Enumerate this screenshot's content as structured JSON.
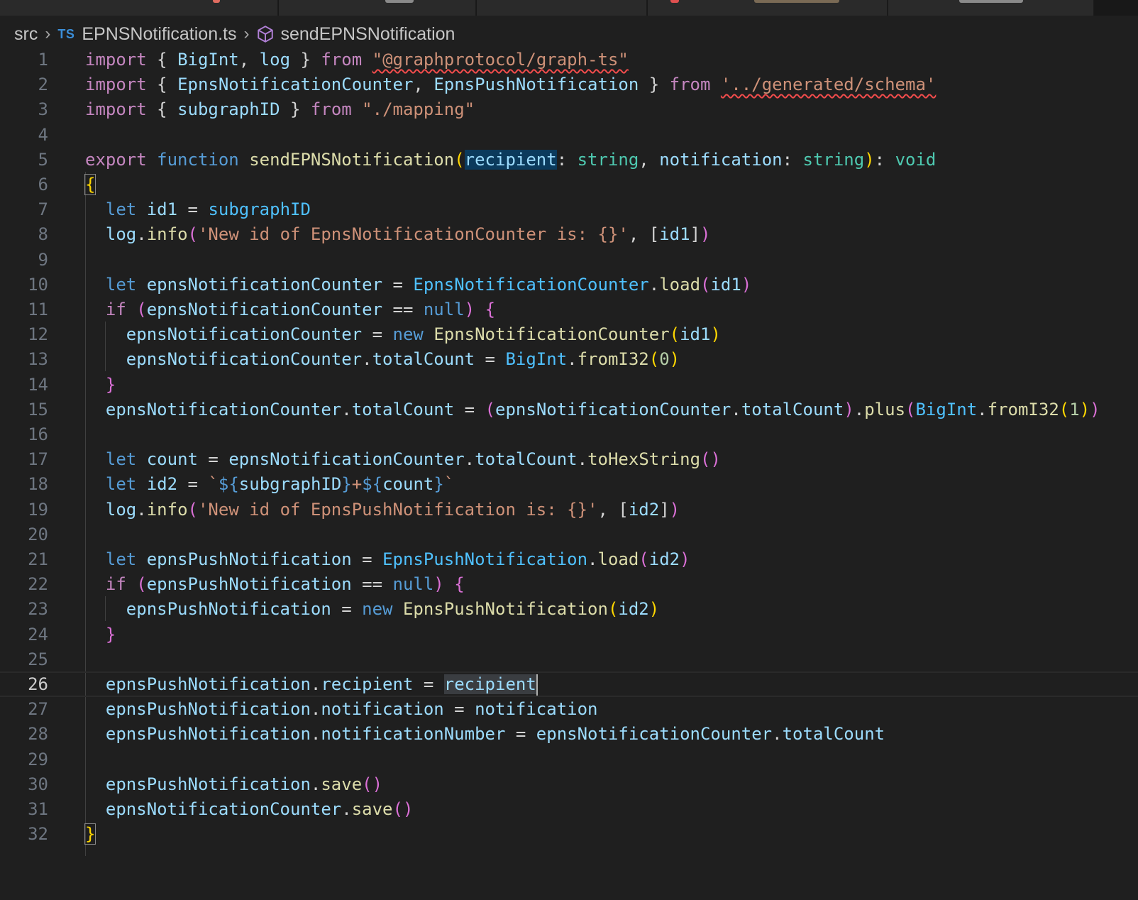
{
  "breadcrumb": {
    "folder": "src",
    "file_badge": "TS",
    "file": "EPNSNotification.ts",
    "symbol": "sendEPNSNotification"
  },
  "editor": {
    "current_line": 26,
    "lines": [
      {
        "n": "1",
        "tokens": [
          [
            "kw-ctrl",
            "import"
          ],
          [
            "p",
            " { "
          ],
          [
            "var",
            "BigInt"
          ],
          [
            "p",
            ", "
          ],
          [
            "var",
            "log"
          ],
          [
            "p",
            " } "
          ],
          [
            "kw-ctrl",
            "from"
          ],
          [
            "p",
            " "
          ],
          [
            "str squig",
            "\"@graphprotocol/graph-ts\""
          ]
        ]
      },
      {
        "n": "2",
        "tokens": [
          [
            "kw-ctrl",
            "import"
          ],
          [
            "p",
            " { "
          ],
          [
            "var",
            "EpnsNotificationCounter"
          ],
          [
            "p",
            ", "
          ],
          [
            "var",
            "EpnsPushNotification"
          ],
          [
            "p",
            " } "
          ],
          [
            "kw-ctrl",
            "from"
          ],
          [
            "p",
            " "
          ],
          [
            "str squig",
            "'../generated/schema'"
          ]
        ]
      },
      {
        "n": "3",
        "tokens": [
          [
            "kw-ctrl",
            "import"
          ],
          [
            "p",
            " { "
          ],
          [
            "var",
            "subgraphID"
          ],
          [
            "p",
            " } "
          ],
          [
            "kw-ctrl",
            "from"
          ],
          [
            "p",
            " "
          ],
          [
            "str",
            "\"./mapping\""
          ]
        ]
      },
      {
        "n": "4",
        "tokens": []
      },
      {
        "n": "5",
        "tokens": [
          [
            "kw-ctrl",
            "export"
          ],
          [
            "p",
            " "
          ],
          [
            "kw",
            "function"
          ],
          [
            "p",
            " "
          ],
          [
            "fn",
            "sendEPNSNotification"
          ],
          [
            "brk",
            "("
          ],
          [
            "var hl-word",
            "recipient"
          ],
          [
            "p",
            ": "
          ],
          [
            "type",
            "string"
          ],
          [
            "p",
            ", "
          ],
          [
            "var",
            "notification"
          ],
          [
            "p",
            ": "
          ],
          [
            "type",
            "string"
          ],
          [
            "brk",
            ")"
          ],
          [
            "p",
            ": "
          ],
          [
            "type",
            "void"
          ]
        ]
      },
      {
        "n": "6",
        "tokens": [
          [
            "brk bracket-match",
            "{"
          ]
        ]
      },
      {
        "n": "7",
        "tokens": [
          [
            "p",
            "  "
          ],
          [
            "kw",
            "let"
          ],
          [
            "p",
            " "
          ],
          [
            "var",
            "id1"
          ],
          [
            "p",
            " = "
          ],
          [
            "cls",
            "subgraphID"
          ]
        ]
      },
      {
        "n": "8",
        "tokens": [
          [
            "p",
            "  "
          ],
          [
            "var",
            "log"
          ],
          [
            "p",
            "."
          ],
          [
            "fn",
            "info"
          ],
          [
            "brk2",
            "("
          ],
          [
            "str",
            "'New id of EpnsNotificationCounter is: {}'"
          ],
          [
            "p",
            ", "
          ],
          [
            "p",
            "["
          ],
          [
            "var",
            "id1"
          ],
          [
            "p",
            "]"
          ],
          [
            "brk2",
            ")"
          ]
        ]
      },
      {
        "n": "9",
        "tokens": []
      },
      {
        "n": "10",
        "tokens": [
          [
            "p",
            "  "
          ],
          [
            "kw",
            "let"
          ],
          [
            "p",
            " "
          ],
          [
            "var",
            "epnsNotificationCounter"
          ],
          [
            "p",
            " = "
          ],
          [
            "cls",
            "EpnsNotificationCounter"
          ],
          [
            "p",
            "."
          ],
          [
            "fn",
            "load"
          ],
          [
            "brk2",
            "("
          ],
          [
            "var",
            "id1"
          ],
          [
            "brk2",
            ")"
          ]
        ]
      },
      {
        "n": "11",
        "tokens": [
          [
            "p",
            "  "
          ],
          [
            "kw-ctrl",
            "if"
          ],
          [
            "p",
            " "
          ],
          [
            "brk2",
            "("
          ],
          [
            "var",
            "epnsNotificationCounter"
          ],
          [
            "p",
            " == "
          ],
          [
            "kw",
            "null"
          ],
          [
            "brk2",
            ")"
          ],
          [
            "p",
            " "
          ],
          [
            "brk2",
            "{"
          ]
        ]
      },
      {
        "n": "12",
        "tokens": [
          [
            "p",
            "    "
          ],
          [
            "var",
            "epnsNotificationCounter"
          ],
          [
            "p",
            " = "
          ],
          [
            "kw",
            "new"
          ],
          [
            "p",
            " "
          ],
          [
            "fn",
            "EpnsNotificationCounter"
          ],
          [
            "brk",
            "("
          ],
          [
            "var",
            "id1"
          ],
          [
            "brk",
            ")"
          ]
        ]
      },
      {
        "n": "13",
        "tokens": [
          [
            "p",
            "    "
          ],
          [
            "var",
            "epnsNotificationCounter"
          ],
          [
            "p",
            "."
          ],
          [
            "var",
            "totalCount"
          ],
          [
            "p",
            " = "
          ],
          [
            "cls",
            "BigInt"
          ],
          [
            "p",
            "."
          ],
          [
            "fn",
            "fromI32"
          ],
          [
            "brk",
            "("
          ],
          [
            "num",
            "0"
          ],
          [
            "brk",
            ")"
          ]
        ]
      },
      {
        "n": "14",
        "tokens": [
          [
            "p",
            "  "
          ],
          [
            "brk2",
            "}"
          ]
        ]
      },
      {
        "n": "15",
        "tokens": [
          [
            "p",
            "  "
          ],
          [
            "var",
            "epnsNotificationCounter"
          ],
          [
            "p",
            "."
          ],
          [
            "var",
            "totalCount"
          ],
          [
            "p",
            " = "
          ],
          [
            "brk2",
            "("
          ],
          [
            "var",
            "epnsNotificationCounter"
          ],
          [
            "p",
            "."
          ],
          [
            "var",
            "totalCount"
          ],
          [
            "brk2",
            ")"
          ],
          [
            "p",
            "."
          ],
          [
            "fn",
            "plus"
          ],
          [
            "brk2",
            "("
          ],
          [
            "cls",
            "BigInt"
          ],
          [
            "p",
            "."
          ],
          [
            "fn",
            "fromI32"
          ],
          [
            "brk",
            "("
          ],
          [
            "num",
            "1"
          ],
          [
            "brk",
            ")"
          ],
          [
            "brk2",
            ")"
          ]
        ]
      },
      {
        "n": "16",
        "tokens": []
      },
      {
        "n": "17",
        "tokens": [
          [
            "p",
            "  "
          ],
          [
            "kw",
            "let"
          ],
          [
            "p",
            " "
          ],
          [
            "var",
            "count"
          ],
          [
            "p",
            " = "
          ],
          [
            "var",
            "epnsNotificationCounter"
          ],
          [
            "p",
            "."
          ],
          [
            "var",
            "totalCount"
          ],
          [
            "p",
            "."
          ],
          [
            "fn",
            "toHexString"
          ],
          [
            "brk2",
            "()"
          ]
        ]
      },
      {
        "n": "18",
        "tokens": [
          [
            "p",
            "  "
          ],
          [
            "kw",
            "let"
          ],
          [
            "p",
            " "
          ],
          [
            "var",
            "id2"
          ],
          [
            "p",
            " = "
          ],
          [
            "str",
            "`"
          ],
          [
            "kw",
            "${"
          ],
          [
            "var",
            "subgraphID"
          ],
          [
            "kw",
            "}"
          ],
          [
            "str",
            "+"
          ],
          [
            "kw",
            "${"
          ],
          [
            "var",
            "count"
          ],
          [
            "kw",
            "}"
          ],
          [
            "str",
            "`"
          ]
        ]
      },
      {
        "n": "19",
        "tokens": [
          [
            "p",
            "  "
          ],
          [
            "var",
            "log"
          ],
          [
            "p",
            "."
          ],
          [
            "fn",
            "info"
          ],
          [
            "brk2",
            "("
          ],
          [
            "str",
            "'New id of EpnsPushNotification is: {}'"
          ],
          [
            "p",
            ", "
          ],
          [
            "p",
            "["
          ],
          [
            "var",
            "id2"
          ],
          [
            "p",
            "]"
          ],
          [
            "brk2",
            ")"
          ]
        ]
      },
      {
        "n": "20",
        "tokens": []
      },
      {
        "n": "21",
        "tokens": [
          [
            "p",
            "  "
          ],
          [
            "kw",
            "let"
          ],
          [
            "p",
            " "
          ],
          [
            "var",
            "epnsPushNotification"
          ],
          [
            "p",
            " = "
          ],
          [
            "cls",
            "EpnsPushNotification"
          ],
          [
            "p",
            "."
          ],
          [
            "fn",
            "load"
          ],
          [
            "brk2",
            "("
          ],
          [
            "var",
            "id2"
          ],
          [
            "brk2",
            ")"
          ]
        ]
      },
      {
        "n": "22",
        "tokens": [
          [
            "p",
            "  "
          ],
          [
            "kw-ctrl",
            "if"
          ],
          [
            "p",
            " "
          ],
          [
            "brk2",
            "("
          ],
          [
            "var",
            "epnsPushNotification"
          ],
          [
            "p",
            " == "
          ],
          [
            "kw",
            "null"
          ],
          [
            "brk2",
            ")"
          ],
          [
            "p",
            " "
          ],
          [
            "brk2",
            "{"
          ]
        ]
      },
      {
        "n": "23",
        "tokens": [
          [
            "p",
            "    "
          ],
          [
            "var",
            "epnsPushNotification"
          ],
          [
            "p",
            " = "
          ],
          [
            "kw",
            "new"
          ],
          [
            "p",
            " "
          ],
          [
            "fn",
            "EpnsPushNotification"
          ],
          [
            "brk",
            "("
          ],
          [
            "var",
            "id2"
          ],
          [
            "brk",
            ")"
          ]
        ]
      },
      {
        "n": "24",
        "tokens": [
          [
            "p",
            "  "
          ],
          [
            "brk2",
            "}"
          ]
        ]
      },
      {
        "n": "25",
        "tokens": []
      },
      {
        "n": "26",
        "tokens": [
          [
            "p",
            "  "
          ],
          [
            "var",
            "epnsPushNotification"
          ],
          [
            "p",
            "."
          ],
          [
            "var",
            "recipient"
          ],
          [
            "p",
            " = "
          ],
          [
            "var hl-sel",
            "recipient"
          ]
        ]
      },
      {
        "n": "27",
        "tokens": [
          [
            "p",
            "  "
          ],
          [
            "var",
            "epnsPushNotification"
          ],
          [
            "p",
            "."
          ],
          [
            "var",
            "notification"
          ],
          [
            "p",
            " = "
          ],
          [
            "var",
            "notification"
          ]
        ]
      },
      {
        "n": "28",
        "tokens": [
          [
            "p",
            "  "
          ],
          [
            "var",
            "epnsPushNotification"
          ],
          [
            "p",
            "."
          ],
          [
            "var",
            "notificationNumber"
          ],
          [
            "p",
            " = "
          ],
          [
            "var",
            "epnsNotificationCounter"
          ],
          [
            "p",
            "."
          ],
          [
            "var",
            "totalCount"
          ]
        ]
      },
      {
        "n": "29",
        "tokens": []
      },
      {
        "n": "30",
        "tokens": [
          [
            "p",
            "  "
          ],
          [
            "var",
            "epnsPushNotification"
          ],
          [
            "p",
            "."
          ],
          [
            "fn",
            "save"
          ],
          [
            "brk2",
            "()"
          ]
        ]
      },
      {
        "n": "31",
        "tokens": [
          [
            "p",
            "  "
          ],
          [
            "var",
            "epnsNotificationCounter"
          ],
          [
            "p",
            "."
          ],
          [
            "fn",
            "save"
          ],
          [
            "brk2",
            "()"
          ]
        ]
      },
      {
        "n": "32",
        "tokens": [
          [
            "brk bracket-match",
            "}"
          ]
        ]
      }
    ]
  }
}
